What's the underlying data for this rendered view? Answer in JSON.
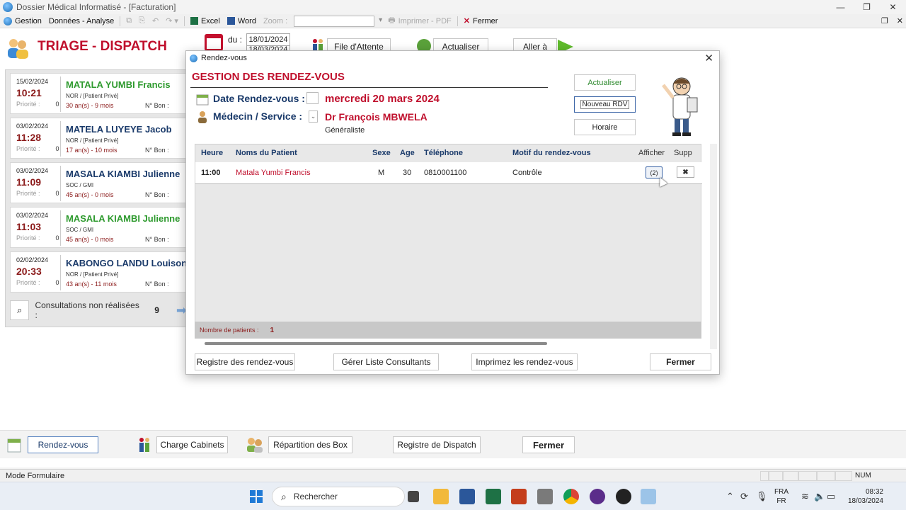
{
  "window": {
    "title": "Dossier Médical Informatisé - [Facturation]",
    "controls": [
      "—",
      "❐",
      "✕"
    ]
  },
  "menubar": {
    "gestion": "Gestion",
    "donnees": "Données - Analyse",
    "excel": "Excel",
    "word": "Word",
    "zoom_label": "Zoom :",
    "zoom_value": "",
    "imprimer": "Imprimer - PDF",
    "fermer": "Fermer",
    "mdi_controls": [
      "❐",
      "✕"
    ]
  },
  "header": {
    "title": "TRIAGE - DISPATCH",
    "du_label": "du :",
    "date_from": "18/01/2024",
    "date_to": "18/03/2024",
    "file_attente": "File d'Attente",
    "actualiser": "Actualiser",
    "aller_a": "Aller à"
  },
  "patients": [
    {
      "date": "15/02/2024",
      "time": "10:21",
      "name": "MATALA YUMBI Francis",
      "name_color": "green",
      "type": "NOR / [Patient Privé]",
      "age": "30 an(s) - 9 mois",
      "priorite_label": "Priorité :",
      "priorite": "0",
      "bon_label": "N° Bon :"
    },
    {
      "date": "03/02/2024",
      "time": "11:28",
      "name": "MATELA LUYEYE Jacob",
      "name_color": "blue",
      "type": "NOR / [Patient Privé]",
      "age": "17 an(s) - 10 mois",
      "priorite_label": "Priorité :",
      "priorite": "0",
      "bon_label": "N° Bon :"
    },
    {
      "date": "03/02/2024",
      "time": "11:09",
      "name": "MASALA KIAMBI Julienne",
      "name_color": "blue",
      "type": "SOC / GMI",
      "age": "45 an(s) - 0 mois",
      "priorite_label": "Priorité :",
      "priorite": "0",
      "bon_label": "N° Bon :"
    },
    {
      "date": "03/02/2024",
      "time": "11:03",
      "name": "MASALA KIAMBI Julienne",
      "name_color": "green",
      "type": "SOC / GMI",
      "age": "45 an(s) - 0 mois",
      "priorite_label": "Priorité :",
      "priorite": "0",
      "bon_label": "N° Bon :"
    },
    {
      "date": "02/02/2024",
      "time": "20:33",
      "name": "KABONGO LANDU Louison",
      "name_color": "blue",
      "type": "NOR / [Patient Privé]",
      "age": "43 an(s) - 11 mois",
      "priorite_label": "Priorité :",
      "priorite": "0",
      "bon_label": "N° Bon :"
    }
  ],
  "consultations": {
    "label": "Consultations non réalisées :",
    "count": "9"
  },
  "dialog": {
    "title": "Rendez-vous",
    "close": "✕",
    "heading": "GESTION DES RENDEZ-VOUS",
    "date_label": "Date Rendez-vous :",
    "date_value": "mercredi 20 mars 2024",
    "medecin_label": "Médecin / Service :",
    "medecin_value": "Dr François MBWELA",
    "specialite": "Généraliste",
    "btn_actualiser": "Actualiser",
    "btn_nouveau": "Nouveau RDV",
    "btn_horaire": "Horaire",
    "columns": {
      "heure": "Heure",
      "noms": "Noms du Patient",
      "sexe": "Sexe",
      "age": "Age",
      "telephone": "Téléphone",
      "motif": "Motif du rendez-vous",
      "afficher": "Afficher",
      "supp": "Supp"
    },
    "rows": [
      {
        "heure": "11:00",
        "nom": "Matala Yumbi Francis",
        "sexe": "M",
        "age": "30",
        "telephone": "0810001100",
        "motif": "Contrôle",
        "afficher": "(2)",
        "supp": "✖"
      }
    ],
    "count_label": "Nombre de patients :",
    "count_value": "1",
    "btn_registre": "Registre des rendez-vous",
    "btn_gerer": "Gérer Liste Consultants",
    "btn_imprimez": "Imprimez les rendez-vous",
    "btn_fermer": "Fermer"
  },
  "bottom": {
    "rendezvous": "Rendez-vous",
    "charge": "Charge Cabinets",
    "repartition": "Répartition des Box",
    "registre": "Registre de Dispatch",
    "fermer": "Fermer"
  },
  "status": {
    "mode": "Mode Formulaire",
    "num": "NUM"
  },
  "taskbar": {
    "search": "Rechercher",
    "lang1": "FRA",
    "lang2": "FR",
    "time": "08:32",
    "date": "18/03/2024"
  },
  "colors": {
    "accent_red": "#c0102d",
    "navy": "#1a3a6a",
    "green": "#2e9a2e",
    "maroon": "#8b1a1a"
  }
}
